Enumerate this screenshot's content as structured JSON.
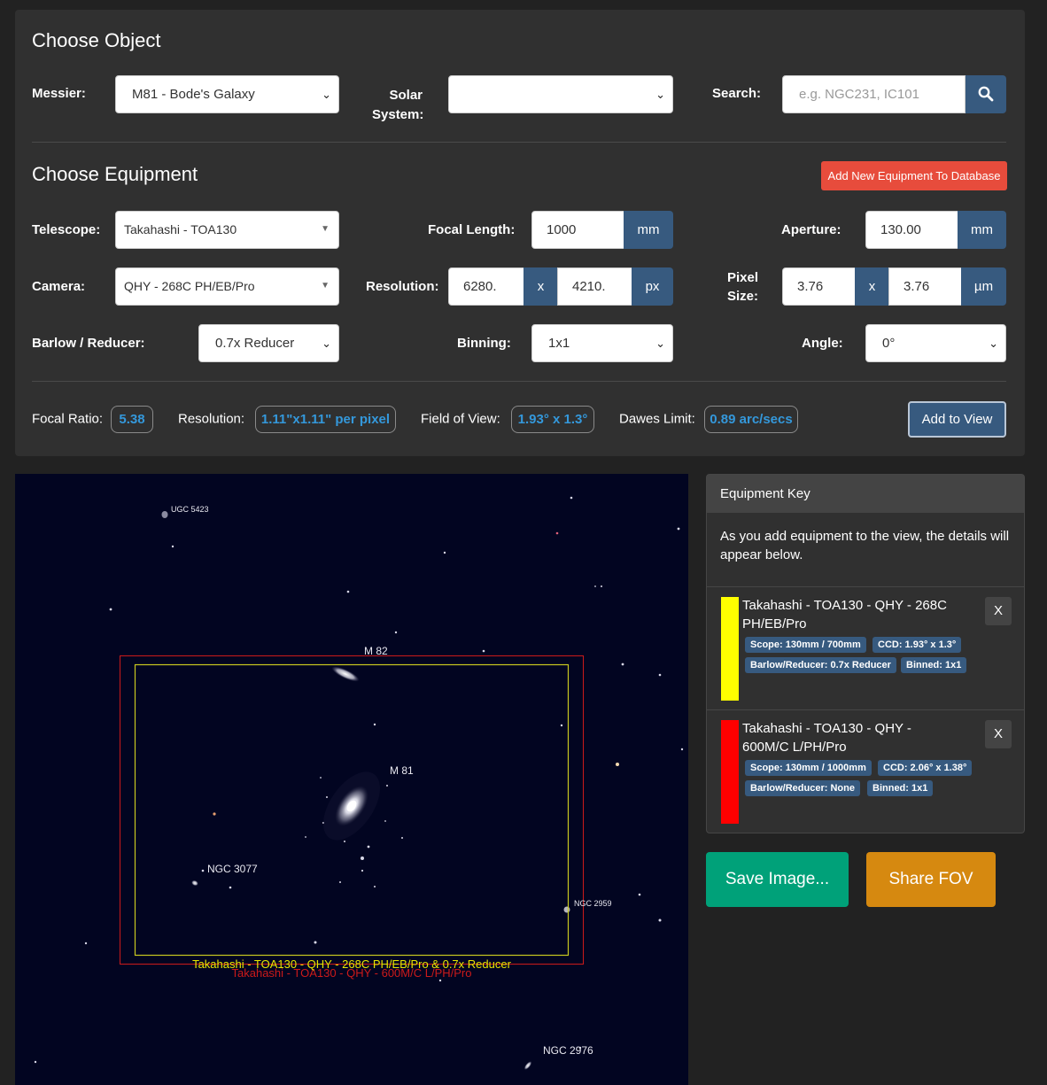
{
  "object": {
    "heading": "Choose Object",
    "messier_label": "Messier:",
    "messier_value": "M81 - Bode's Galaxy",
    "solar_label_1": "Solar",
    "solar_label_2": "System:",
    "solar_value": "",
    "search_label": "Search:",
    "search_placeholder": "e.g. NGC231, IC101"
  },
  "equipment": {
    "heading": "Choose Equipment",
    "add_new_button": "Add New Equipment To Database",
    "telescope_label": "Telescope:",
    "telescope_value": "Takahashi - TOA130",
    "focal_length_label": "Focal Length:",
    "focal_length_value": "1000",
    "focal_length_unit": "mm",
    "aperture_label": "Aperture:",
    "aperture_value": "130.00",
    "aperture_unit": "mm",
    "camera_label": "Camera:",
    "camera_value": "QHY - 268C PH/EB/Pro",
    "resolution_label": "Resolution:",
    "resolution_x": "6280.",
    "resolution_sep": "x",
    "resolution_y": "4210.",
    "resolution_unit": "px",
    "pixel_size_label_1": "Pixel",
    "pixel_size_label_2": "Size:",
    "pixel_x": "3.76",
    "pixel_sep": "x",
    "pixel_y": "3.76",
    "pixel_unit": "µm",
    "barlow_label": "Barlow / Reducer:",
    "barlow_value": "0.7x Reducer",
    "binning_label": "Binning:",
    "binning_value": "1x1",
    "angle_label": "Angle:",
    "angle_value": "0°"
  },
  "stats": {
    "focal_ratio_label": "Focal Ratio:",
    "focal_ratio_value": "5.38",
    "resolution_label": "Resolution:",
    "resolution_value": "1.11\"x1.11\" per pixel",
    "fov_label": "Field of View:",
    "fov_value": "1.93° x 1.3°",
    "dawes_label": "Dawes Limit:",
    "dawes_value": "0.89 arc/secs",
    "add_to_view_button": "Add to View"
  },
  "sky": {
    "labels": {
      "ugc5423": "UGC 5423",
      "m82": "M 82",
      "m81": "M 81",
      "ngc3077": "NGC 3077",
      "ngc2959": "NGC 2959",
      "ngc2976": "NGC 2976"
    },
    "fov_yellow_caption": "Takahashi - TOA130 - QHY - 268C PH/EB/Pro  & 0.7x Reducer",
    "fov_red_caption": "Takahashi - TOA130 - QHY - 600M/C L/PH/Pro",
    "yellow_color": "#e6e600",
    "red_color": "#cc1a1a"
  },
  "key": {
    "heading": "Equipment Key",
    "description": "As you add equipment to the view, the details will appear below.",
    "items": [
      {
        "color": "#ffff00",
        "title": "Takahashi - TOA130 - QHY - 268C PH/EB/Pro",
        "remove": "X",
        "scope": "Scope: 130mm / 700mm",
        "ccd": "CCD: 1.93° x 1.3°",
        "barlow": "Barlow/Reducer: 0.7x Reducer",
        "binned": "Binned: 1x1"
      },
      {
        "color": "#ff0000",
        "title": "Takahashi - TOA130 - QHY - 600M/C L/PH/Pro",
        "remove": "X",
        "scope": "Scope: 130mm / 1000mm",
        "ccd": "CCD: 2.06° x 1.38°",
        "barlow": "Barlow/Reducer: None",
        "binned": "Binned: 1x1"
      }
    ]
  },
  "actions": {
    "save_image": "Save Image...",
    "share_fov": "Share FOV"
  }
}
